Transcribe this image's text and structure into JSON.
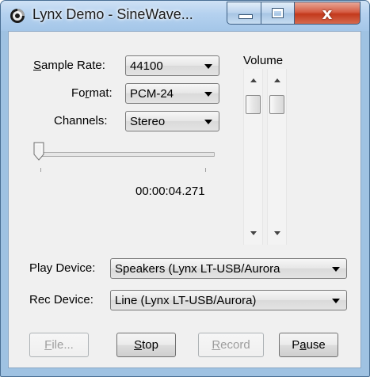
{
  "window": {
    "title": "Lynx Demo - SineWave...",
    "close_glyph": "x"
  },
  "sample_rate": {
    "label_mnemonic": "S",
    "label_rest": "ample Rate:",
    "value": "44100"
  },
  "format": {
    "label_pre": "Fo",
    "label_mnemonic": "r",
    "label_rest": "mat:",
    "value": "PCM-24"
  },
  "channels": {
    "label": "Channels:",
    "value": "Stereo"
  },
  "position": {
    "time": "00:00:04.271",
    "level": 0.0
  },
  "volume": {
    "label": "Volume",
    "left_level": 1.0,
    "right_level": 1.0
  },
  "play_device": {
    "label": "Play Device:",
    "value": "Speakers (Lynx LT-USB/Aurora"
  },
  "rec_device": {
    "label": "Rec Device:",
    "value": "Line (Lynx LT-USB/Aurora)"
  },
  "buttons": {
    "file": {
      "mnemonic": "F",
      "rest": "ile..."
    },
    "stop": {
      "mnemonic": "S",
      "rest": "top"
    },
    "record": {
      "mnemonic": "R",
      "rest": "ecord"
    },
    "pause": {
      "pre": "P",
      "mnemonic": "a",
      "rest": "use"
    }
  },
  "icons": {
    "app": "app-icon",
    "minimize": "minimize-icon",
    "maximize": "maximize-icon",
    "close": "close-icon",
    "dropdown": "chevron-down-icon",
    "scroll_up": "arrow-up-icon",
    "scroll_down": "arrow-down-icon"
  }
}
